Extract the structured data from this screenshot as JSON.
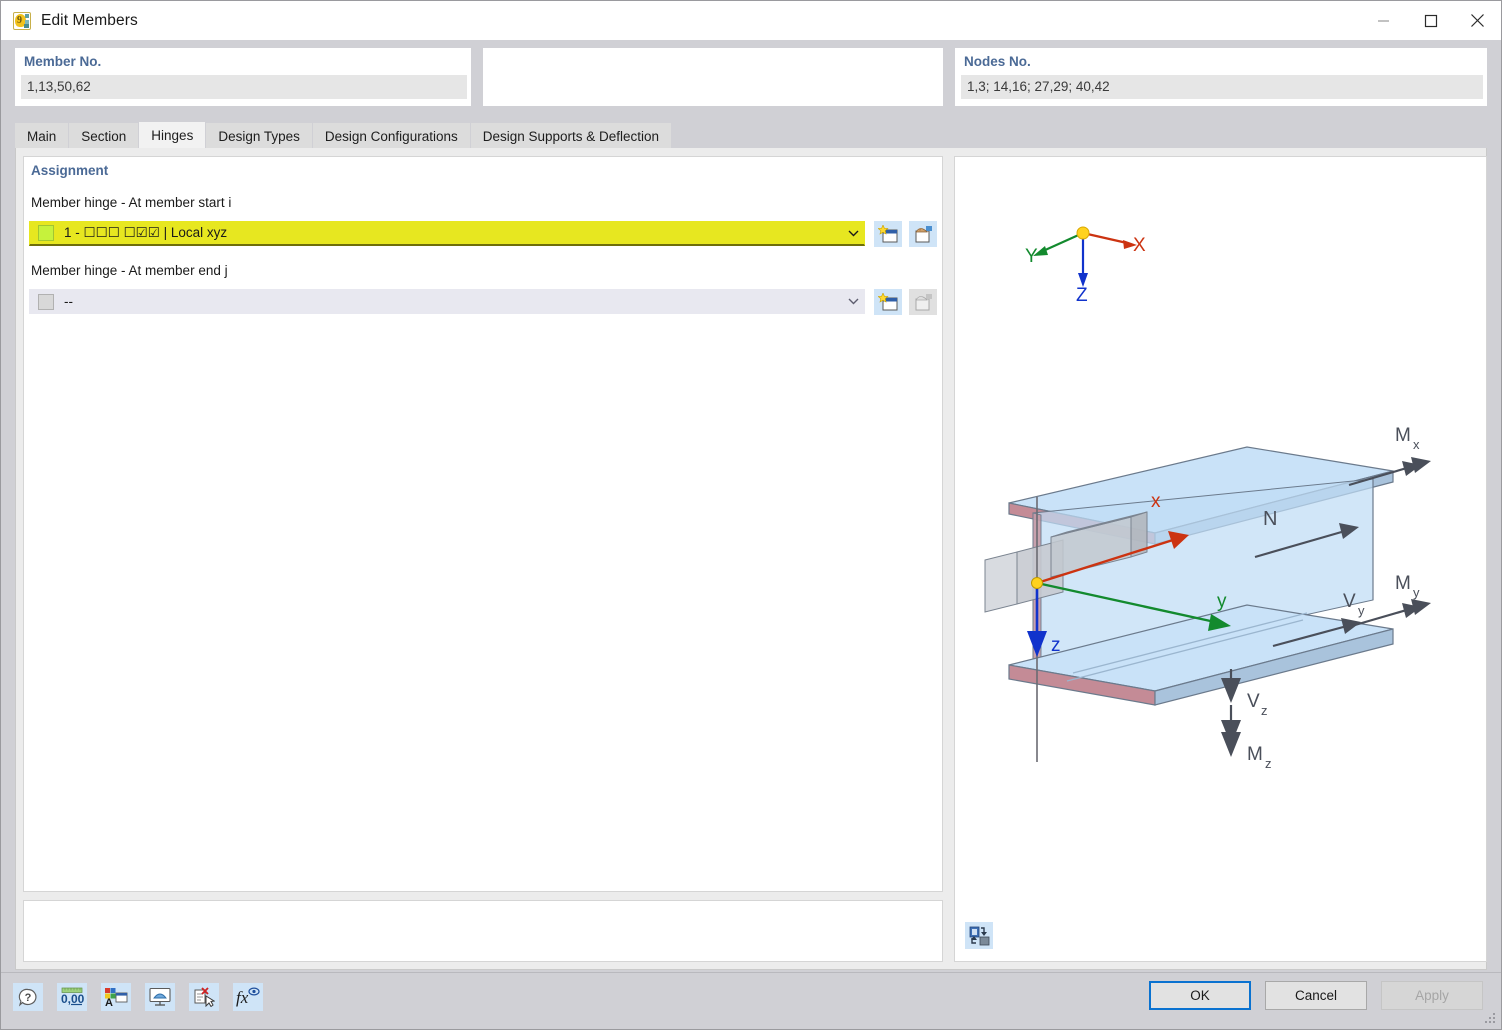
{
  "window": {
    "title": "Edit Members",
    "app_icon": "app-icon",
    "controls": {
      "minimize": "minimize-icon",
      "maximize": "maximize-icon",
      "close": "close-icon"
    }
  },
  "header": {
    "member_no": {
      "label": "Member No.",
      "value": "1,13,50,62"
    },
    "middle": {
      "label": "",
      "value": ""
    },
    "nodes_no": {
      "label": "Nodes No.",
      "value": "1,3; 14,16; 27,29; 40,42"
    }
  },
  "tabs": [
    {
      "label": "Main",
      "active": false
    },
    {
      "label": "Section",
      "active": false
    },
    {
      "label": "Hinges",
      "active": true
    },
    {
      "label": "Design Types",
      "active": false
    },
    {
      "label": "Design Configurations",
      "active": false
    },
    {
      "label": "Design Supports & Deflection",
      "active": false
    }
  ],
  "assignment": {
    "section_title": "Assignment",
    "start": {
      "label": "Member hinge - At member start i",
      "value": "1 - ☐☐☐  ☐☑☑ | Local xyz",
      "swatch_color": "#c6f23c",
      "highlight_color": "#e7e720",
      "new_button": "new-member-hinge-button",
      "edit_button": "edit-member-hinge-button"
    },
    "end": {
      "label": "Member hinge - At member end j",
      "value": "--",
      "swatch_color": "#d8d8d8",
      "new_button": "new-member-hinge-button",
      "edit_button": "edit-member-hinge-button"
    }
  },
  "graphic": {
    "global_axes": [
      {
        "name": "X",
        "color": "#cc3311"
      },
      {
        "name": "Y",
        "color": "#138a2e"
      },
      {
        "name": "Z",
        "color": "#1133cc"
      }
    ],
    "local_axes": [
      {
        "name": "x",
        "color": "#cc3311"
      },
      {
        "name": "y",
        "color": "#138a2e"
      },
      {
        "name": "z",
        "color": "#1133cc"
      }
    ],
    "force_labels": [
      "N",
      "Vy",
      "Vz",
      "Mx",
      "My",
      "Mz"
    ],
    "view_toggle": "toggle-view-button",
    "beam_flange_color": "#c48b96",
    "beam_web_color": "#bfdcf5"
  },
  "footer": {
    "tools": [
      {
        "name": "help-icon",
        "title": "Help"
      },
      {
        "name": "decimal-places-icon",
        "title": "0,00"
      },
      {
        "name": "display-properties-icon",
        "title": "Display Properties"
      },
      {
        "name": "visualization-icon",
        "title": "Visualization"
      },
      {
        "name": "delete-icon",
        "title": "Delete"
      },
      {
        "name": "formula-icon",
        "title": "fx"
      }
    ],
    "buttons": [
      {
        "label": "OK",
        "state": "default"
      },
      {
        "label": "Cancel",
        "state": "normal"
      },
      {
        "label": "Apply",
        "state": "disabled"
      }
    ]
  }
}
